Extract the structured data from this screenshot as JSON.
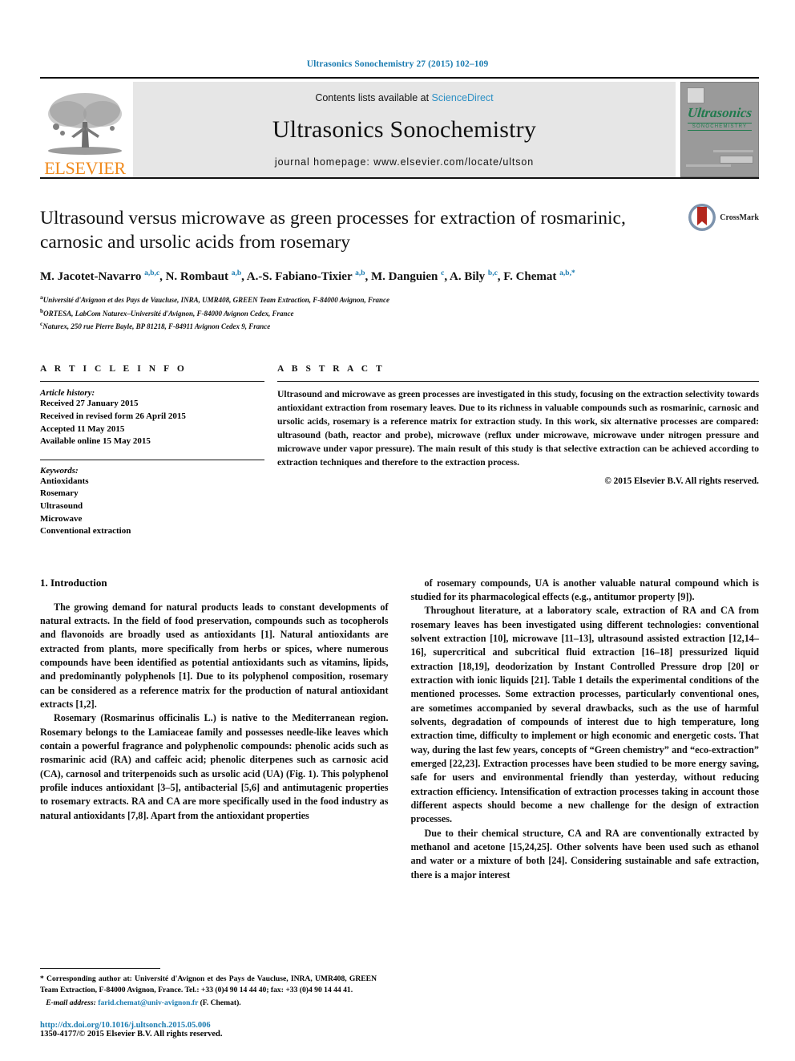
{
  "running_head": "Ultrasonics Sonochemistry 27 (2015) 102–109",
  "masthead": {
    "publisher": "ELSEVIER",
    "contents_prefix": "Contents lists available at ",
    "contents_link": "ScienceDirect",
    "journal_name": "Ultrasonics Sonochemistry",
    "homepage": "journal homepage: www.elsevier.com/locate/ultson",
    "cover_title": "Ultrasonics",
    "cover_subtitle": "SONOCHEMISTRY"
  },
  "article": {
    "title": "Ultrasound versus microwave as green processes for extraction of rosmarinic, carnosic and ursolic acids from rosemary",
    "crossmark_label": "CrossMark",
    "authors_html": "M. Jacotet-Navarro <sup>a,b,c</sup>, N. Rombaut <sup>a,b</sup>, A.-S. Fabiano-Tixier <sup>a,b</sup>, M. Danguien <sup>c</sup>, A. Bily <sup>b,c</sup>, F. Chemat <sup>a,b,</sup><sup>*</sup>",
    "affiliations": [
      {
        "mark": "a",
        "text": "Université d'Avignon et des Pays de Vaucluse, INRA, UMR408, GREEN Team Extraction, F-84000 Avignon, France"
      },
      {
        "mark": "b",
        "text": "ORTESA, LabCom Naturex–Université d'Avignon, F-84000 Avignon Cedex, France"
      },
      {
        "mark": "c",
        "text": "Naturex, 250 rue Pierre Bayle, BP 81218, F-84911 Avignon Cedex 9, France"
      }
    ]
  },
  "article_info": {
    "heading": "A R T I C L E    I N F O",
    "history_label": "Article history:",
    "history": [
      "Received 27 January 2015",
      "Received in revised form 26 April 2015",
      "Accepted 11 May 2015",
      "Available online 15 May 2015"
    ],
    "keywords_label": "Keywords:",
    "keywords": [
      "Antioxidants",
      "Rosemary",
      "Ultrasound",
      "Microwave",
      "Conventional extraction"
    ]
  },
  "abstract": {
    "heading": "A B S T R A C T",
    "text": "Ultrasound and microwave as green processes are investigated in this study, focusing on the extraction selectivity towards antioxidant extraction from rosemary leaves. Due to its richness in valuable compounds such as rosmarinic, carnosic and ursolic acids, rosemary is a reference matrix for extraction study. In this work, six alternative processes are compared: ultrasound (bath, reactor and probe), microwave (reflux under microwave, microwave under nitrogen pressure and microwave under vapor pressure). The main result of this study is that selective extraction can be achieved according to extraction techniques and therefore to the extraction process.",
    "copyright": "© 2015 Elsevier B.V. All rights reserved."
  },
  "body": {
    "section_heading": "1. Introduction",
    "left_paragraphs": [
      "The growing demand for natural products leads to constant developments of natural extracts. In the field of food preservation, compounds such as tocopherols and flavonoids are broadly used as antioxidants [1]. Natural antioxidants are extracted from plants, more specifically from herbs or spices, where numerous compounds have been identified as potential antioxidants such as vitamins, lipids, and predominantly polyphenols [1]. Due to its polyphenol composition, rosemary can be considered as a reference matrix for the production of natural antioxidant extracts [1,2].",
      "Rosemary (Rosmarinus officinalis L.) is native to the Mediterranean region. Rosemary belongs to the Lamiaceae family and possesses needle-like leaves which contain a powerful fragrance and polyphenolic compounds: phenolic acids such as rosmarinic acid (RA) and caffeic acid; phenolic diterpenes such as carnosic acid (CA), carnosol and triterpenoids such as ursolic acid (UA) (Fig. 1). This polyphenol profile induces antioxidant [3–5], antibacterial [5,6] and antimutagenic properties to rosemary extracts. RA and CA are more specifically used in the food industry as natural antioxidants [7,8]. Apart from the antioxidant properties"
    ],
    "right_paragraphs": [
      "of rosemary compounds, UA is another valuable natural compound which is studied for its pharmacological effects (e.g., antitumor property [9]).",
      "Throughout literature, at a laboratory scale, extraction of RA and CA from rosemary leaves has been investigated using different technologies: conventional solvent extraction [10], microwave [11–13], ultrasound assisted extraction [12,14–16], supercritical and subcritical fluid extraction [16–18] pressurized liquid extraction [18,19], deodorization by Instant Controlled Pressure drop [20] or extraction with ionic liquids [21]. Table 1 details the experimental conditions of the mentioned processes. Some extraction processes, particularly conventional ones, are sometimes accompanied by several drawbacks, such as the use of harmful solvents, degradation of compounds of interest due to high temperature, long extraction time, difficulty to implement or high economic and energetic costs. That way, during the last few years, concepts of \"Green chemistry\" and \"eco-extraction\" emerged [22,23]. Extraction processes have been studied to be more energy saving, safe for users and environmental friendly than yesterday, without reducing extraction efficiency. Intensification of extraction processes taking in account those different aspects should become a new challenge for the design of extraction processes.",
      "Due to their chemical structure, CA and RA are conventionally extracted by methanol and acetone [15,24,25]. Other solvents have been used such as ethanol and water or a mixture of both [24]. Considering sustainable and safe extraction, there is a major interest"
    ]
  },
  "footnote": {
    "corresponding": "* Corresponding author at: Université d'Avignon et des Pays de Vaucluse, INRA, UMR408, GREEN Team Extraction, F-84000 Avignon, France. Tel.: +33 (0)4 90 14 44 40; fax: +33 (0)4 90 14 44 41.",
    "email_label": "E-mail address:",
    "email": "farid.chemat@univ-avignon.fr",
    "email_suffix": "(F. Chemat).",
    "doi": "http://dx.doi.org/10.1016/j.ultsonch.2015.05.006",
    "issn": "1350-4177/© 2015 Elsevier B.V. All rights reserved."
  },
  "colors": {
    "link": "#1a7bb0",
    "elsevier_orange": "#f08a1c",
    "cover_green": "#1f7a4d",
    "sciencedirect": "#2b8fc4"
  }
}
